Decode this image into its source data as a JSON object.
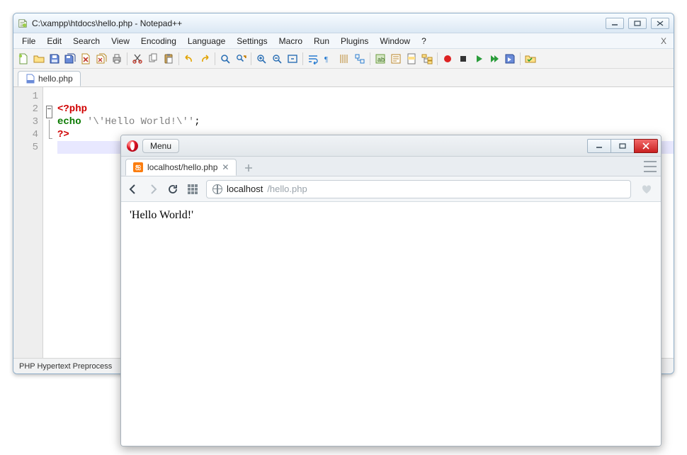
{
  "notepad": {
    "title": "C:\\xampp\\htdocs\\hello.php - Notepad++",
    "menus": [
      "File",
      "Edit",
      "Search",
      "View",
      "Encoding",
      "Language",
      "Settings",
      "Macro",
      "Run",
      "Plugins",
      "Window",
      "?"
    ],
    "close_x": "X",
    "toolbar_icons": [
      "new-file",
      "open-folder",
      "save",
      "save-all",
      "close-file",
      "close-all",
      "print",
      "sep",
      "cut",
      "copy",
      "paste",
      "sep",
      "undo",
      "redo",
      "sep",
      "find",
      "replace",
      "sep",
      "zoom-in",
      "zoom-out",
      "fit",
      "sep",
      "word-wrap",
      "show-all",
      "indent-guide",
      "fold",
      "sep",
      "user-lang",
      "func-list",
      "doc-map",
      "folder-tree",
      "sep",
      "record-macro",
      "stop-macro",
      "play-macro",
      "play-multi",
      "save-macro",
      "sep",
      "spell-check"
    ],
    "tab_label": "hello.php",
    "lines": {
      "1": "",
      "2": {
        "open": "<?php"
      },
      "3": {
        "kw": "echo",
        "sp": " ",
        "str": "'\\'Hello World!\\''",
        "semi": ";"
      },
      "4": {
        "close": "?>"
      },
      "5": ""
    },
    "status": "PHP Hypertext Preprocess"
  },
  "browser": {
    "menu_label": "Menu",
    "tab_label": "localhost/hello.php",
    "address_host": "localhost",
    "address_path": "/hello.php",
    "page_body": "'Hello World!'"
  }
}
